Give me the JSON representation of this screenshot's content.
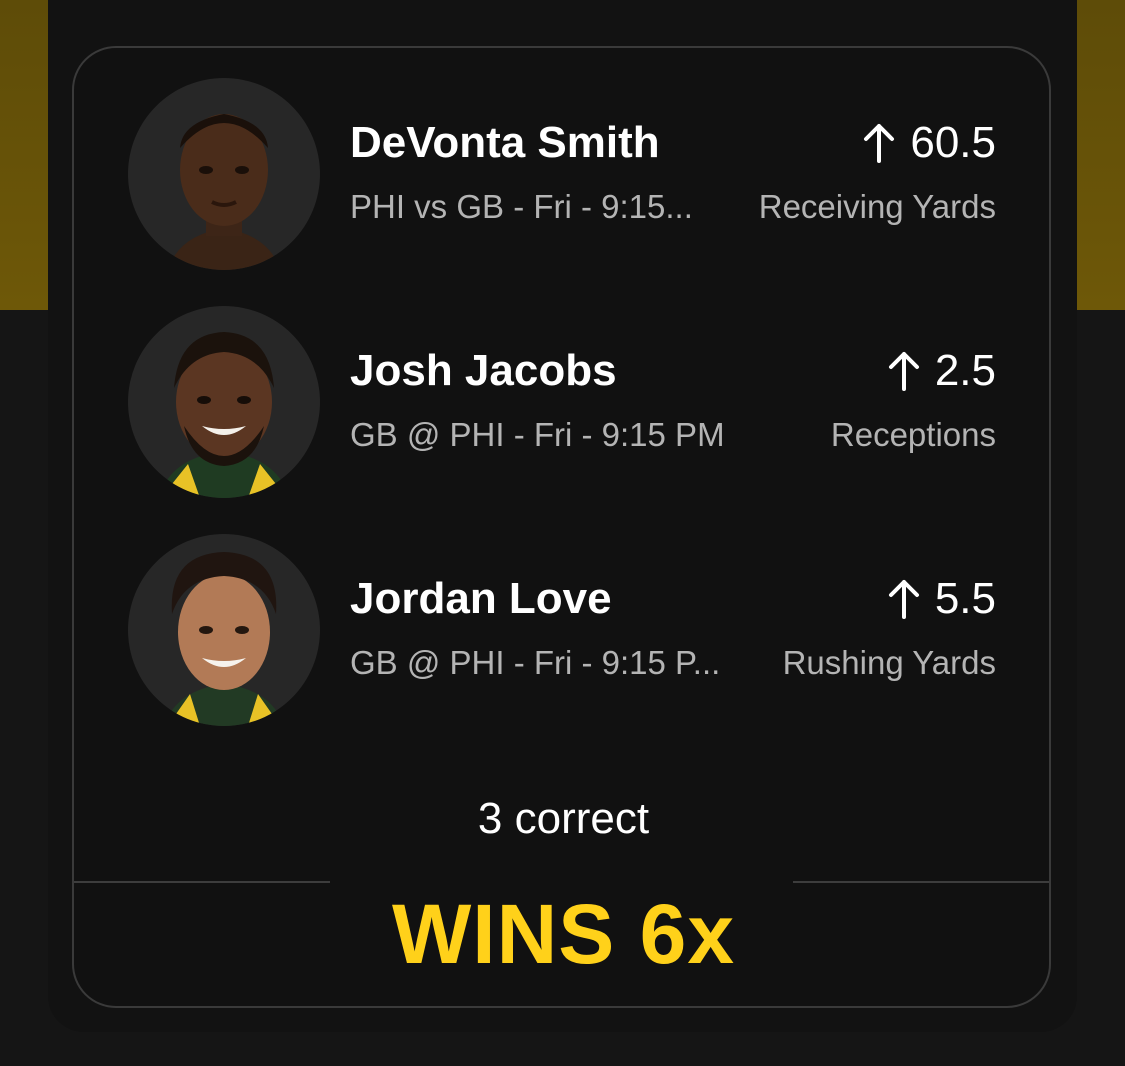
{
  "picks": [
    {
      "player": "DeVonta Smith",
      "matchup": "PHI  vs GB - Fri - 9:15...",
      "line": "60.5",
      "stat": "Receiving Yards",
      "direction_icon": "arrow-up-icon"
    },
    {
      "player": "Josh Jacobs",
      "matchup": "GB  @ PHI - Fri - 9:15 PM",
      "line": "2.5",
      "stat": "Receptions",
      "direction_icon": "arrow-up-icon"
    },
    {
      "player": "Jordan Love",
      "matchup": "GB  @ PHI - Fri - 9:15 P...",
      "line": "5.5",
      "stat": "Rushing Yards",
      "direction_icon": "arrow-up-icon"
    }
  ],
  "result": {
    "correct_label": "3 correct",
    "payout_label": "WINS 6x"
  },
  "colors": {
    "accent_gold": "#ffd11a",
    "band_gold": "#6e5808",
    "card_bg": "#111111"
  }
}
